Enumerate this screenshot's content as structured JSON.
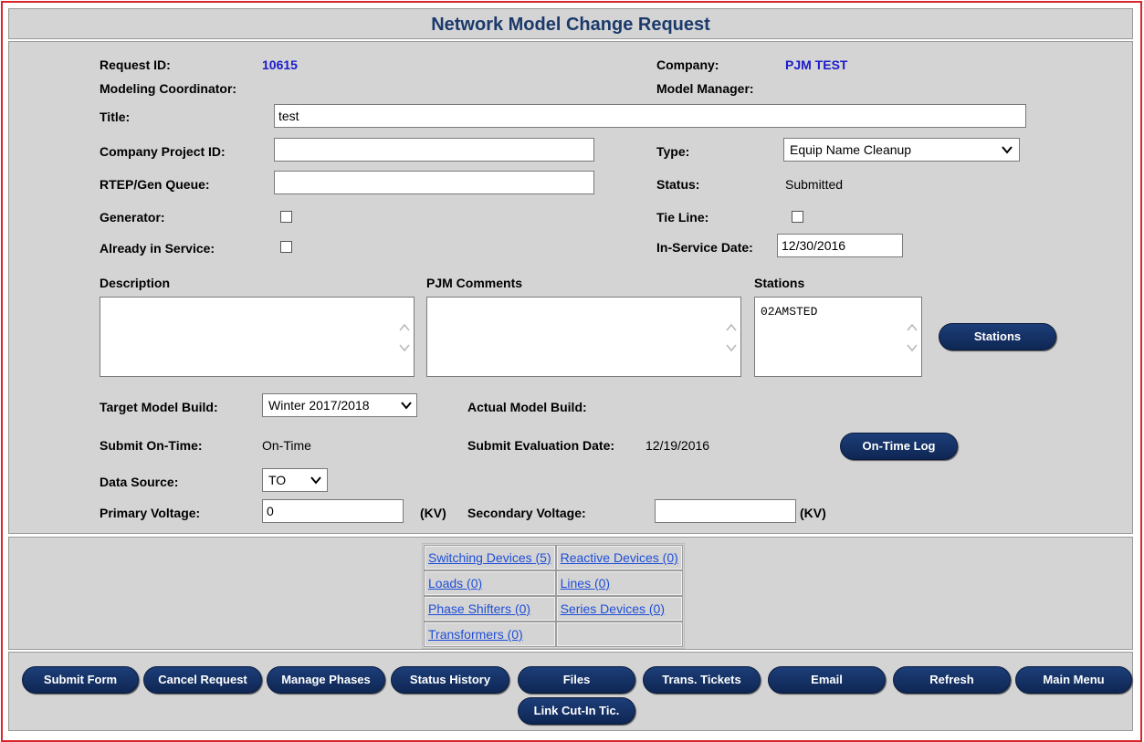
{
  "title": "Network Model Change Request",
  "request": {
    "request_id_label": "Request ID:",
    "request_id": "10615",
    "company_label": "Company:",
    "company": "PJM TEST",
    "modeling_coordinator_label": "Modeling Coordinator:",
    "model_manager_label": "Model Manager:",
    "title_label": "Title:",
    "title_value": "test",
    "company_project_id_label": "Company Project ID:",
    "company_project_id": "",
    "type_label": "Type:",
    "type_value": "Equip Name Cleanup",
    "rtep_label": "RTEP/Gen Queue:",
    "rtep_value": "",
    "status_label": "Status:",
    "status_value": "Submitted",
    "generator_label": "Generator:",
    "tie_line_label": "Tie Line:",
    "already_in_service_label": "Already in Service:",
    "in_service_date_label": "In-Service Date:",
    "in_service_date": "12/30/2016",
    "description_label": "Description",
    "description_value": "",
    "pjm_comments_label": "PJM Comments",
    "pjm_comments_value": "",
    "stations_label": "Stations",
    "stations_value": "02AMSTED",
    "stations_button": "Stations",
    "target_model_build_label": "Target Model Build:",
    "target_model_build": "Winter 2017/2018",
    "actual_model_build_label": "Actual Model Build:",
    "submit_on_time_label": "Submit On-Time:",
    "submit_on_time": "On-Time",
    "submit_eval_date_label": "Submit Evaluation Date:",
    "submit_eval_date": "12/19/2016",
    "on_time_log_button": "On-Time Log",
    "data_source_label": "Data Source:",
    "data_source": "TO",
    "primary_voltage_label": "Primary Voltage:",
    "primary_voltage": "0",
    "kv_label_1": "(KV)",
    "secondary_voltage_label": "Secondary Voltage:",
    "secondary_voltage": "",
    "kv_label_2": "(KV)"
  },
  "links": [
    [
      "Switching Devices (5)",
      "Reactive Devices (0)"
    ],
    [
      "Loads (0)",
      "Lines (0)"
    ],
    [
      "Phase Shifters (0)",
      "Series Devices (0)"
    ],
    [
      "Transformers (0)",
      ""
    ]
  ],
  "buttons": {
    "submit_form": "Submit Form",
    "cancel_request": "Cancel Request",
    "manage_phases": "Manage Phases",
    "status_history": "Status History",
    "files": "Files",
    "trans_tickets": "Trans. Tickets",
    "email": "Email",
    "refresh": "Refresh",
    "main_menu": "Main Menu",
    "link_cut_in": "Link Cut-In Tic."
  },
  "colors": {
    "button_navy": "#0e2653",
    "title_text": "#1b3a6b",
    "value_blue": "#1a1acc",
    "link_blue": "#1f4ed8",
    "panel_gray": "#d4d4d4",
    "frame_red": "#d9262a"
  },
  "icons": {
    "select_arrow": "chevron-down-icon",
    "scroll_arrows": "scroll-arrows-icon"
  }
}
